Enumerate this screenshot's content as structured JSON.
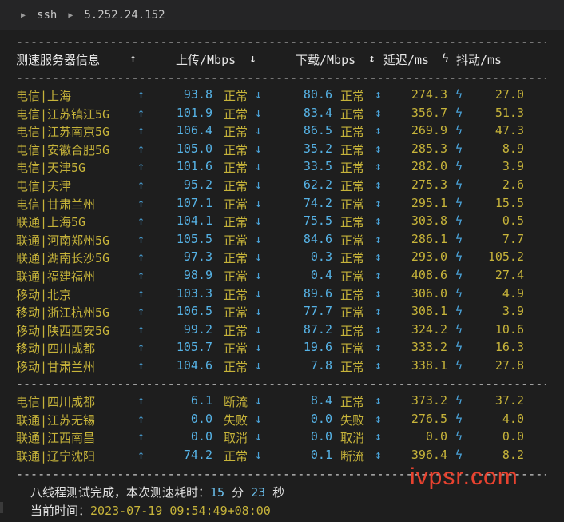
{
  "titlebar": {
    "crumb1": "ssh",
    "crumb2": "5.252.24.152"
  },
  "rule_text": "------------------------------------------------------------------------------------------------------------",
  "header": {
    "info": "测速服务器信息",
    "up": "上传/Mbps",
    "down": "下载/Mbps",
    "latency": "延迟/ms",
    "jitter": "抖动/ms"
  },
  "rows": [
    {
      "name": "电信|上海",
      "up": "93.8",
      "up_status": "正常",
      "down": "80.6",
      "down_status": "正常",
      "latency": "274.3",
      "jitter": "27.0"
    },
    {
      "name": "电信|江苏镇江5G",
      "up": "101.9",
      "up_status": "正常",
      "down": "83.4",
      "down_status": "正常",
      "latency": "356.7",
      "jitter": "51.3"
    },
    {
      "name": "电信|江苏南京5G",
      "up": "106.4",
      "up_status": "正常",
      "down": "86.5",
      "down_status": "正常",
      "latency": "269.9",
      "jitter": "47.3"
    },
    {
      "name": "电信|安徽合肥5G",
      "up": "105.0",
      "up_status": "正常",
      "down": "35.2",
      "down_status": "正常",
      "latency": "285.3",
      "jitter": "8.9"
    },
    {
      "name": "电信|天津5G",
      "up": "101.6",
      "up_status": "正常",
      "down": "33.5",
      "down_status": "正常",
      "latency": "282.0",
      "jitter": "3.9"
    },
    {
      "name": "电信|天津",
      "up": "95.2",
      "up_status": "正常",
      "down": "62.2",
      "down_status": "正常",
      "latency": "275.3",
      "jitter": "2.6"
    },
    {
      "name": "电信|甘肃兰州",
      "up": "107.1",
      "up_status": "正常",
      "down": "74.2",
      "down_status": "正常",
      "latency": "295.1",
      "jitter": "15.5"
    },
    {
      "name": "联通|上海5G",
      "up": "104.1",
      "up_status": "正常",
      "down": "75.5",
      "down_status": "正常",
      "latency": "303.8",
      "jitter": "0.5"
    },
    {
      "name": "联通|河南郑州5G",
      "up": "105.5",
      "up_status": "正常",
      "down": "84.6",
      "down_status": "正常",
      "latency": "286.1",
      "jitter": "7.7"
    },
    {
      "name": "联通|湖南长沙5G",
      "up": "97.3",
      "up_status": "正常",
      "down": "0.3",
      "down_status": "正常",
      "latency": "293.0",
      "jitter": "105.2"
    },
    {
      "name": "联通|福建福州",
      "up": "98.9",
      "up_status": "正常",
      "down": "0.4",
      "down_status": "正常",
      "latency": "408.6",
      "jitter": "27.4"
    },
    {
      "name": "移动|北京",
      "up": "103.3",
      "up_status": "正常",
      "down": "89.6",
      "down_status": "正常",
      "latency": "306.0",
      "jitter": "4.9"
    },
    {
      "name": "移动|浙江杭州5G",
      "up": "106.5",
      "up_status": "正常",
      "down": "77.7",
      "down_status": "正常",
      "latency": "308.1",
      "jitter": "3.9"
    },
    {
      "name": "移动|陕西西安5G",
      "up": "99.2",
      "up_status": "正常",
      "down": "87.2",
      "down_status": "正常",
      "latency": "324.2",
      "jitter": "10.6"
    },
    {
      "name": "移动|四川成都",
      "up": "105.7",
      "up_status": "正常",
      "down": "19.6",
      "down_status": "正常",
      "latency": "333.2",
      "jitter": "16.3"
    },
    {
      "name": "移动|甘肃兰州",
      "up": "104.6",
      "up_status": "正常",
      "down": "7.8",
      "down_status": "正常",
      "latency": "338.1",
      "jitter": "27.8"
    }
  ],
  "rows2": [
    {
      "name": "电信|四川成都",
      "up": "6.1",
      "up_status": "断流",
      "down": "8.4",
      "down_status": "正常",
      "latency": "373.2",
      "jitter": "37.2"
    },
    {
      "name": "联通|江苏无锡",
      "up": "0.0",
      "up_status": "失败",
      "down": "0.0",
      "down_status": "失败",
      "latency": "276.5",
      "jitter": "4.0"
    },
    {
      "name": "联通|江西南昌",
      "up": "0.0",
      "up_status": "取消",
      "down": "0.0",
      "down_status": "取消",
      "latency": "0.0",
      "jitter": "0.0"
    },
    {
      "name": "联通|辽宁沈阳",
      "up": "74.2",
      "up_status": "正常",
      "down": "0.1",
      "down_status": "断流",
      "latency": "396.4",
      "jitter": "8.2"
    }
  ],
  "footer": {
    "done_prefix": "八线程测试完成，本次测速耗时：",
    "minutes": "15",
    "min_unit": "分",
    "seconds": "23",
    "sec_unit": "秒",
    "time_label": "当前时间：",
    "time_value": "2023-07-19 09:54:49+08:00"
  },
  "watermark": "ivpsr.com",
  "colors": {
    "background": "#1e1e1e",
    "label_yellow": "#c7b43a",
    "value_blue": "#56b3e6",
    "watermark_red": "#e8422f"
  }
}
